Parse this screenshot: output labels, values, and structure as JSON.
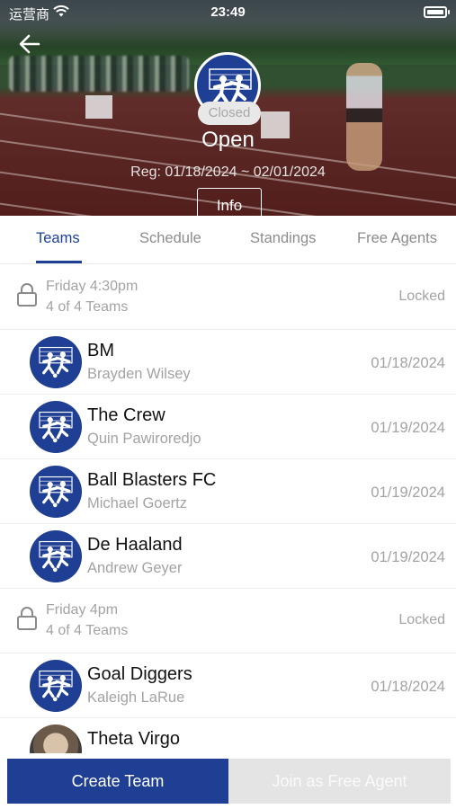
{
  "status_bar": {
    "carrier": "运营商",
    "time": "23:49"
  },
  "header": {
    "status_badge": "Closed",
    "title": "Open",
    "registration": "Reg: 01/18/2024 ~ 02/01/2024",
    "info_label": "Info"
  },
  "tabs": [
    {
      "label": "Teams",
      "active": true
    },
    {
      "label": "Schedule",
      "active": false
    },
    {
      "label": "Standings",
      "active": false
    },
    {
      "label": "Free Agents",
      "active": false
    }
  ],
  "groups": [
    {
      "day": "Friday 4:30pm",
      "count": "4 of 4 Teams",
      "status": "Locked",
      "teams": [
        {
          "name": "BM",
          "captain": "Brayden Wilsey",
          "date": "01/18/2024"
        },
        {
          "name": "The Crew",
          "captain": "Quin Pawiroredjo",
          "date": "01/19/2024"
        },
        {
          "name": "Ball Blasters FC",
          "captain": "Michael Goertz",
          "date": "01/19/2024"
        },
        {
          "name": "De Haaland",
          "captain": "Andrew Geyer",
          "date": "01/19/2024"
        }
      ]
    },
    {
      "day": "Friday 4pm",
      "count": "4 of 4 Teams",
      "status": "Locked",
      "teams": [
        {
          "name": "Goal Diggers",
          "captain": "Kaleigh LaRue",
          "date": "01/18/2024"
        },
        {
          "name": "Theta Virgo",
          "captain": "",
          "date": ""
        }
      ]
    }
  ],
  "actions": {
    "create_team": "Create Team",
    "join_free_agent": "Join as Free Agent"
  },
  "colors": {
    "accent": "#1e3f93",
    "muted_text": "#a3a3a3",
    "disabled_button": "#e4e4e4"
  }
}
